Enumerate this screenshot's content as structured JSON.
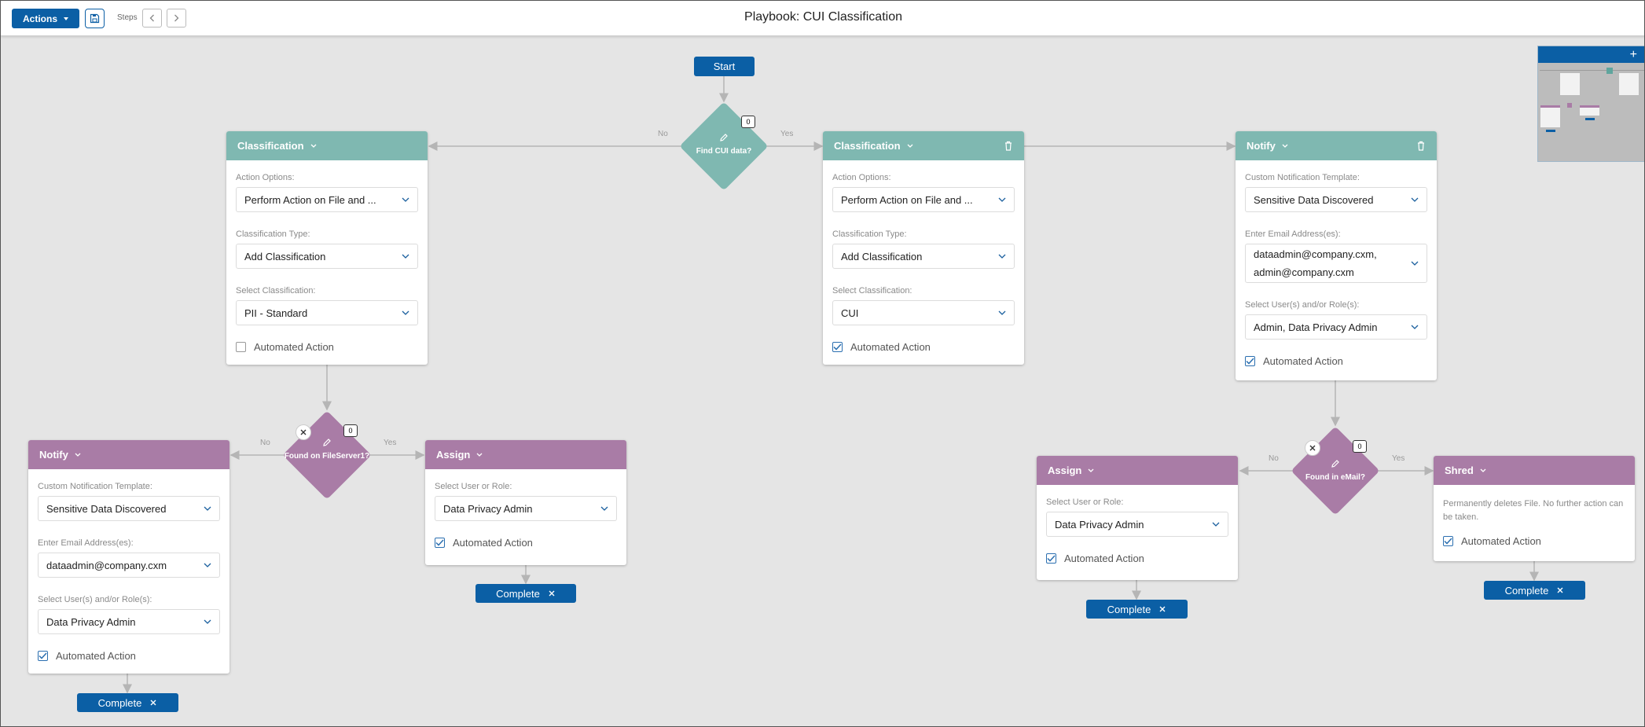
{
  "toolbar": {
    "actions_label": "Actions",
    "steps_label": "Steps",
    "title": "Playbook: CUI Classification"
  },
  "flow": {
    "start_label": "Start",
    "yes_label": "Yes",
    "no_label": "No",
    "decisions": [
      {
        "label": "Find CUI data?",
        "count": "0",
        "color": "#7fb8b1"
      },
      {
        "label": "Found on FileServer1?",
        "count": "0",
        "color": "#a97ca6"
      },
      {
        "label": "Found in eMail?",
        "count": "0",
        "color": "#a97ca6"
      }
    ],
    "cards": {
      "classification_left": {
        "title": "Classification",
        "action_options_label": "Action Options:",
        "action_options_value": "Perform Action on File and ...",
        "classification_type_label": "Classification Type:",
        "classification_type_value": "Add Classification",
        "select_classification_label": "Select Classification:",
        "select_classification_value": "PII - Standard",
        "automated_label": "Automated Action",
        "automated_checked": false
      },
      "classification_right": {
        "title": "Classification",
        "action_options_label": "Action Options:",
        "action_options_value": "Perform Action on File and ...",
        "classification_type_label": "Classification Type:",
        "classification_type_value": "Add Classification",
        "select_classification_label": "Select Classification:",
        "select_classification_value": "CUI",
        "automated_label": "Automated Action",
        "automated_checked": true
      },
      "notify_top": {
        "title": "Notify",
        "template_label": "Custom Notification Template:",
        "template_value": "Sensitive Data Discovered",
        "email_label": "Enter Email Address(es):",
        "email_value": "dataadmin@company.cxm,\nadmin@company.cxm",
        "users_label": "Select User(s) and/or Role(s):",
        "users_value": "Admin, Data Privacy Admin",
        "automated_label": "Automated Action",
        "automated_checked": true
      },
      "notify_left": {
        "title": "Notify",
        "template_label": "Custom Notification Template:",
        "template_value": "Sensitive Data Discovered",
        "email_label": "Enter Email Address(es):",
        "email_value": "dataadmin@company.cxm",
        "users_label": "Select User(s) and/or Role(s):",
        "users_value": "Data Privacy Admin",
        "automated_label": "Automated Action",
        "automated_checked": true
      },
      "assign_mid": {
        "title": "Assign",
        "user_label": "Select User or Role:",
        "user_value": "Data Privacy Admin",
        "automated_label": "Automated Action",
        "automated_checked": true
      },
      "assign_right": {
        "title": "Assign",
        "user_label": "Select User or Role:",
        "user_value": "Data Privacy Admin",
        "automated_label": "Automated Action",
        "automated_checked": true
      },
      "shred": {
        "title": "Shred",
        "description": "Permanently deletes File. No further action can be taken.",
        "automated_label": "Automated Action",
        "automated_checked": true
      }
    },
    "complete_label": "Complete"
  },
  "minimap": {
    "add_label": "+"
  }
}
